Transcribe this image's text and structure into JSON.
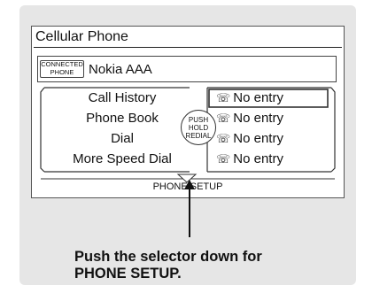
{
  "screen": {
    "title": "Cellular Phone",
    "connected_badge": {
      "line1": "CONNECTED",
      "line2": "PHONE"
    },
    "device_name": "Nokia AAA",
    "menu_items": [
      "Call History",
      "Phone Book",
      "Dial",
      "More Speed Dial"
    ],
    "speed_dial_entries": [
      "No entry",
      "No entry",
      "No entry",
      "No entry"
    ],
    "center_button": {
      "line1": "PUSH",
      "line2": "HOLD",
      "line3": "REDIAL"
    },
    "bottom_hint": "PHONE SETUP"
  },
  "caption": {
    "line1": "Push the selector down for",
    "line2": "PHONE SETUP."
  }
}
